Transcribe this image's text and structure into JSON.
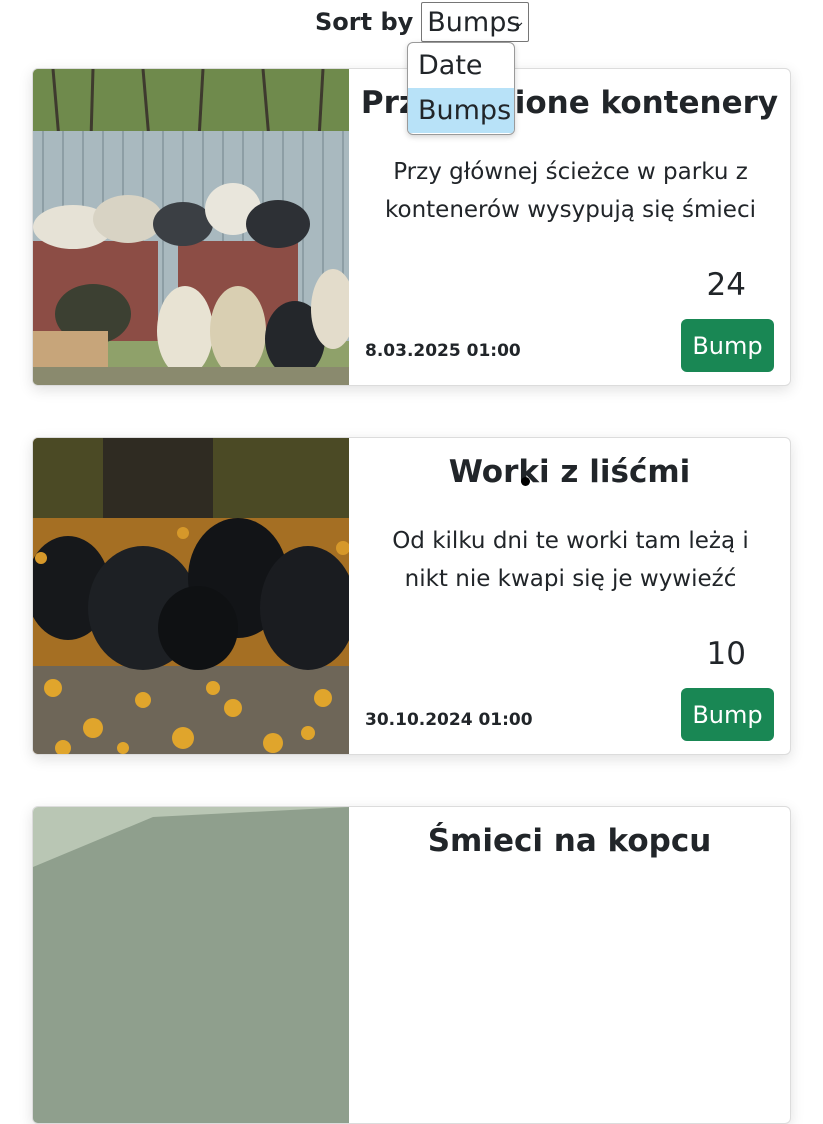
{
  "sort": {
    "label": "Sort by",
    "selected": "Bumps",
    "options": [
      {
        "label": "Date",
        "selected": false
      },
      {
        "label": "Bumps",
        "selected": true
      }
    ]
  },
  "colors": {
    "bump_button": "#198754",
    "selected_option": "#b8e2f8",
    "text": "#212529"
  },
  "posts": [
    {
      "title": "Przepełnione kontenery",
      "description": "Przy głównej ścieżce w parku z kontenerów wysypują się śmieci",
      "date": "8.03.2025 01:00",
      "bumps": "24",
      "button_label": "Bump",
      "image": "overflowing-trash-containers-photo"
    },
    {
      "title": "Worki z liśćmi",
      "description": "Od kilku dni te worki tam leżą i nikt nie kwapi się je wywieźć",
      "date": "30.10.2024 01:00",
      "bumps": "10",
      "button_label": "Bump",
      "image": "leaf-bags-photo"
    },
    {
      "title": "Śmieci na kopcu",
      "image": "hill-photo"
    }
  ]
}
